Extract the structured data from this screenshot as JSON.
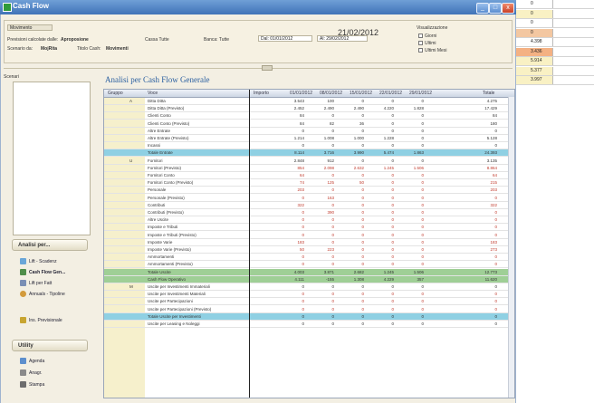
{
  "window": {
    "title": "Cash Flow",
    "buttons": [
      "_",
      "□",
      "x"
    ]
  },
  "sheet_strip": {
    "rows": [
      {
        "value": "0",
        "color": "#ffffff"
      },
      {
        "value": "0",
        "color": "#f9f1c4"
      },
      {
        "value": "0",
        "color": "#ffffff"
      },
      {
        "value": "0",
        "color": "#f3c7a1"
      },
      {
        "value": "4.398",
        "color": "#ffffff"
      },
      {
        "value": "3.436",
        "color": "#f4b183"
      },
      {
        "value": "5.914",
        "color": "#f9f1c4"
      },
      {
        "value": "5.377",
        "color": "#f9f1c4"
      },
      {
        "value": "3.997",
        "color": "#f9f1c4"
      }
    ]
  },
  "header": {
    "scenario_field": "Movimento",
    "date": "21/02/2012",
    "labels": {
      "previsioni": "Previsioni calcolate dalle:",
      "previsioni_val": "Aproposione",
      "scenario": "Scenario da:",
      "scenario_val": "MojRita",
      "cassa": "Cassa Tutte",
      "banca": "Banca: Tutte",
      "dal": "Dal: 01/01/2012",
      "al": "Al: 29/02/2012",
      "titolo": "Titolo Cash:",
      "titolo_val": "Movimenti"
    },
    "options_title": "Visualizzazione",
    "options": [
      "Giorni",
      "Ultimi",
      "Ultimi Mesi"
    ]
  },
  "left": {
    "scenari_label": "Scenari",
    "analisi_header": "Analisi per...",
    "analisi_items": [
      {
        "icon": "chart-icon",
        "label": "Lift - Scadenz"
      },
      {
        "icon": "cash-flow-icon",
        "label": "Cash Flow Gen..."
      },
      {
        "icon": "list-icon",
        "label": "Lift per Fatt"
      },
      {
        "icon": "people-icon",
        "label": "Annuals - Tipoline"
      }
    ],
    "extra_item": "Ins. Previsionale",
    "utility_header": "Utility",
    "utility_items": [
      {
        "icon": "calendar-icon",
        "label": "Agenda"
      },
      {
        "icon": "users-icon",
        "label": "Anagr."
      },
      {
        "icon": "print-icon",
        "label": "Stampa"
      }
    ]
  },
  "grid": {
    "title": "Analisi per Cash Flow Generale",
    "columns": [
      "Gruppo",
      "Voce",
      "Importo",
      "01/01/2012",
      "08/01/2012",
      "15/01/2012",
      "22/01/2012",
      "29/01/2012",
      "Totale"
    ],
    "rows": [
      {
        "code": "A",
        "label": "Ditta Ditta",
        "vals": [
          "3.543",
          "100",
          "0",
          "0",
          "0",
          "4.275"
        ],
        "style": ""
      },
      {
        "code": "",
        "label": "Ditta Ditta (Previsto)",
        "vals": [
          "2.452",
          "2.490",
          "2.490",
          "4.220",
          "1.828",
          "17.429"
        ],
        "style": ""
      },
      {
        "code": "",
        "label": "Clienti Conto",
        "vals": [
          "84",
          "0",
          "0",
          "0",
          "0",
          "84"
        ],
        "style": ""
      },
      {
        "code": "",
        "label": "Clienti Conto (Previsto)",
        "vals": [
          "84",
          "82",
          "36",
          "0",
          "0",
          "180"
        ],
        "style": ""
      },
      {
        "code": "",
        "label": "Altre Entrate",
        "vals": [
          "0",
          "0",
          "0",
          "0",
          "0",
          "0"
        ],
        "style": ""
      },
      {
        "code": "",
        "label": "Altre Entrate (Previsto)",
        "vals": [
          "1.214",
          "1.008",
          "1.000",
          "1.228",
          "0",
          "5.128"
        ],
        "style": ""
      },
      {
        "code": "",
        "label": "Incassi",
        "vals": [
          "0",
          "0",
          "0",
          "0",
          "0",
          "0"
        ],
        "style": ""
      },
      {
        "code": "",
        "label": "Totale Entrate",
        "vals": [
          "8.114",
          "3.716",
          "3.990",
          "5.474",
          "1.863",
          "24.393"
        ],
        "style": "hl"
      },
      {
        "code": "U",
        "label": "Fornitori",
        "vals": [
          "2.848",
          "912",
          "0",
          "0",
          "0",
          "3.135"
        ],
        "style": ""
      },
      {
        "code": "",
        "label": "Fornitori (Previsto)",
        "vals": [
          "854",
          "2.098",
          "2.632",
          "1.245",
          "1.506",
          "8.864"
        ],
        "style": "red"
      },
      {
        "code": "",
        "label": "Fornitori Conto",
        "vals": [
          "64",
          "0",
          "0",
          "0",
          "0",
          "64"
        ],
        "style": "red"
      },
      {
        "code": "",
        "label": "Fornitori Conto (Previsto)",
        "vals": [
          "74",
          "125",
          "50",
          "0",
          "0",
          "215"
        ],
        "style": "red"
      },
      {
        "code": "",
        "label": "Personale",
        "vals": [
          "203",
          "0",
          "0",
          "0",
          "0",
          "203"
        ],
        "style": "red"
      },
      {
        "code": "",
        "label": "Personale (Previsto)",
        "vals": [
          "0",
          "163",
          "0",
          "0",
          "0",
          "0"
        ],
        "style": "red"
      },
      {
        "code": "",
        "label": "Contributi",
        "vals": [
          "322",
          "0",
          "0",
          "0",
          "0",
          "322"
        ],
        "style": "red"
      },
      {
        "code": "",
        "label": "Contributi (Previsto)",
        "vals": [
          "0",
          "390",
          "0",
          "0",
          "0",
          "0"
        ],
        "style": "red"
      },
      {
        "code": "",
        "label": "Altre Uscite",
        "vals": [
          "0",
          "0",
          "0",
          "0",
          "0",
          "0"
        ],
        "style": "red"
      },
      {
        "code": "",
        "label": "Imposte e Tributi",
        "vals": [
          "0",
          "0",
          "0",
          "0",
          "0",
          "0"
        ],
        "style": "red"
      },
      {
        "code": "",
        "label": "Imposte e Tributi (Previsto)",
        "vals": [
          "0",
          "0",
          "0",
          "0",
          "0",
          "0"
        ],
        "style": "red"
      },
      {
        "code": "",
        "label": "Imposte Varie",
        "vals": [
          "183",
          "0",
          "0",
          "0",
          "0",
          "183"
        ],
        "style": "red"
      },
      {
        "code": "",
        "label": "Imposte Varie (Previsto)",
        "vals": [
          "50",
          "223",
          "0",
          "0",
          "0",
          "273"
        ],
        "style": "red"
      },
      {
        "code": "",
        "label": "Ammortamenti",
        "vals": [
          "0",
          "0",
          "0",
          "0",
          "0",
          "0"
        ],
        "style": "red"
      },
      {
        "code": "",
        "label": "Ammortamenti (Previsto)",
        "vals": [
          "0",
          "0",
          "0",
          "0",
          "0",
          "0"
        ],
        "style": "red"
      },
      {
        "code": "",
        "label": "Totale Uscite",
        "vals": [
          "4.003",
          "3.871",
          "2.682",
          "1.245",
          "1.506",
          "12.773"
        ],
        "style": "hlg"
      },
      {
        "code": "",
        "label": "Cash Flow Operativo",
        "vals": [
          "4.111",
          "-155",
          "1.308",
          "4.229",
          "357",
          "11.620"
        ],
        "style": "hlg"
      },
      {
        "code": "M",
        "label": "Uscite per Investimenti Immateriali",
        "vals": [
          "0",
          "0",
          "0",
          "0",
          "0",
          "0"
        ],
        "style": ""
      },
      {
        "code": "",
        "label": "Uscite per Investimenti Materiali",
        "vals": [
          "0",
          "0",
          "0",
          "0",
          "0",
          "0"
        ],
        "style": "red"
      },
      {
        "code": "",
        "label": "Uscite per Partecipazioni",
        "vals": [
          "0",
          "0",
          "0",
          "0",
          "0",
          "0"
        ],
        "style": "red"
      },
      {
        "code": "",
        "label": "Uscite per Partecipazioni (Previsto)",
        "vals": [
          "0",
          "0",
          "0",
          "0",
          "0",
          "0"
        ],
        "style": "red"
      },
      {
        "code": "",
        "label": "Totale Uscite per Investimenti",
        "vals": [
          "0",
          "0",
          "0",
          "0",
          "0",
          "0"
        ],
        "style": "hl"
      },
      {
        "code": "",
        "label": "Uscite per Leasing e Noleggi",
        "vals": [
          "0",
          "0",
          "0",
          "0",
          "0",
          "0"
        ],
        "style": ""
      }
    ]
  }
}
